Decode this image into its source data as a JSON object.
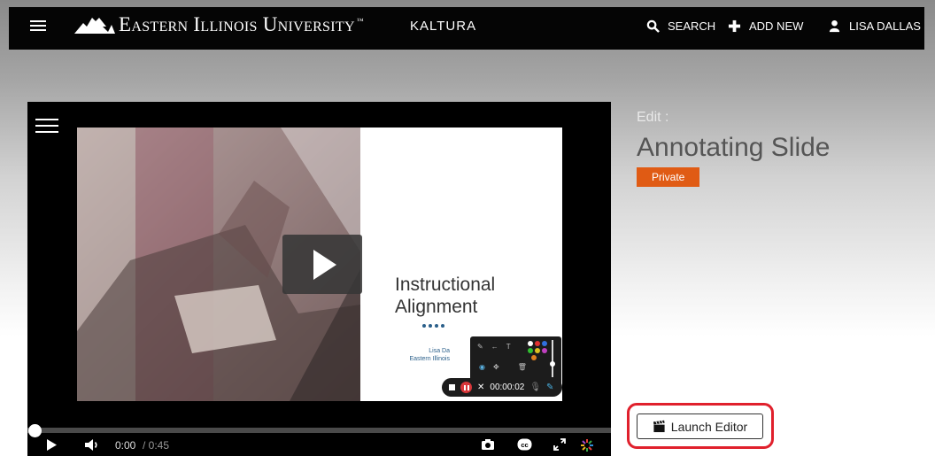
{
  "header": {
    "university_name": "Eastern Illinois University",
    "trademark": "™",
    "brand": "KALTURA",
    "nav": {
      "search_label": "SEARCH",
      "add_new_label": "ADD NEW",
      "user_label": "LISA DALLAS"
    },
    "icons": [
      "menu-icon",
      "university-logo-icon",
      "search-icon",
      "plus-icon",
      "user-icon"
    ]
  },
  "player": {
    "slide": {
      "title_line1": "Instructional",
      "title_line2": "Alignment",
      "author_line1": "Lisa Da",
      "author_line2": "Eastern Illinois"
    },
    "recording_time": "00:00:02",
    "current_time": "0:00",
    "duration": "/ 0:45",
    "progress": 0,
    "icons": [
      "player-menu-icon",
      "play-icon",
      "volume-icon",
      "camera-icon",
      "cc-icon",
      "fullscreen-icon",
      "kaltura-logo-icon"
    ]
  },
  "entry": {
    "edit_label": "Edit :",
    "title": "Annotating Slide",
    "privacy": "Private",
    "launch_editor_label": "Launch Editor"
  },
  "colors": {
    "topbar_bg": "#050505",
    "privacy_badge": "#e05b14",
    "highlight_outline": "#e0202c",
    "record_button": "#d9373a"
  }
}
